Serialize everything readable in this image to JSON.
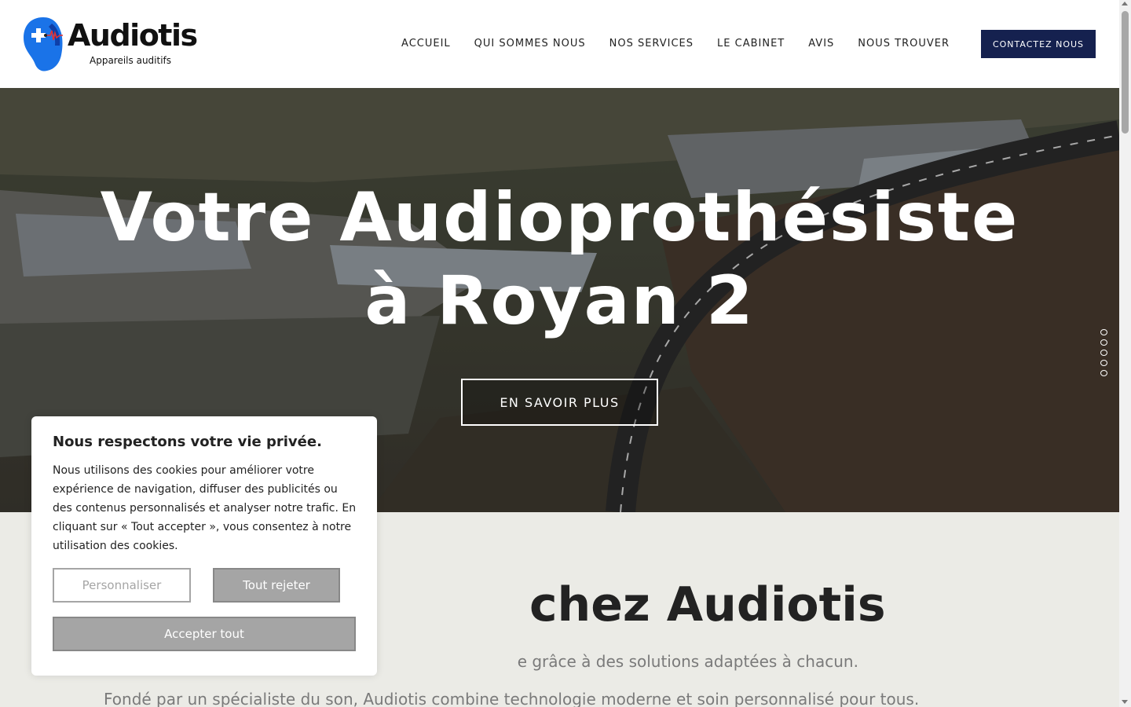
{
  "brand": {
    "name": "Audiotis",
    "tagline": "Appareils auditifs",
    "colors": {
      "navy": "#15214f",
      "blue": "#1a73e8",
      "accent_red": "#e8312f"
    }
  },
  "nav": {
    "items": [
      {
        "label": "ACCUEIL"
      },
      {
        "label": "QUI SOMMES NOUS"
      },
      {
        "label": "NOS SERVICES"
      },
      {
        "label": "LE CABINET"
      },
      {
        "label": "AVIS"
      },
      {
        "label": "NOUS TROUVER"
      }
    ],
    "cta_label": "CONTACTEZ NOUS"
  },
  "hero": {
    "title_line1": "Votre Audioprothésiste",
    "title_line2": "à Royan 2",
    "button_label": "EN SAVOIR PLUS",
    "slide_count": 5
  },
  "section": {
    "title_visible": "chez Audiotis",
    "lead_visible": "e grâce à des solutions adaptées à chacun.",
    "paragraph": "Fondé par un spécialiste du son, Audiotis combine technologie moderne et soin personnalisé pour tous."
  },
  "cookie": {
    "title": "Nous respectons votre vie privée.",
    "text": "Nous utilisons des cookies pour améliorer votre expérience de navigation, diffuser des publicités ou des contenus personnalisés et analyser notre trafic. En cliquant sur « Tout accepter », vous consentez à notre utilisation des cookies.",
    "customize_label": "Personnaliser",
    "reject_label": "Tout rejeter",
    "accept_label": "Accepter tout"
  }
}
